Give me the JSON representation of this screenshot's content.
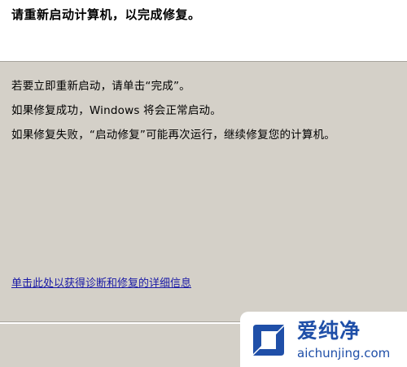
{
  "header": {
    "title": "请重新启动计算机，以完成修复。"
  },
  "messages": {
    "line1": "若要立即重新启动，请单击“完成”。",
    "line2": "如果修复成功，Windows 将会正常启动。",
    "line3": "如果修复失败，“启动修复”可能再次运行，继续修复您的计算机。"
  },
  "link": {
    "details": "单击此处以获得诊断和修复的详细信息"
  },
  "watermark": {
    "name": "爱纯净",
    "domain": "aichunjing.com",
    "color": "#1f4fa8"
  }
}
